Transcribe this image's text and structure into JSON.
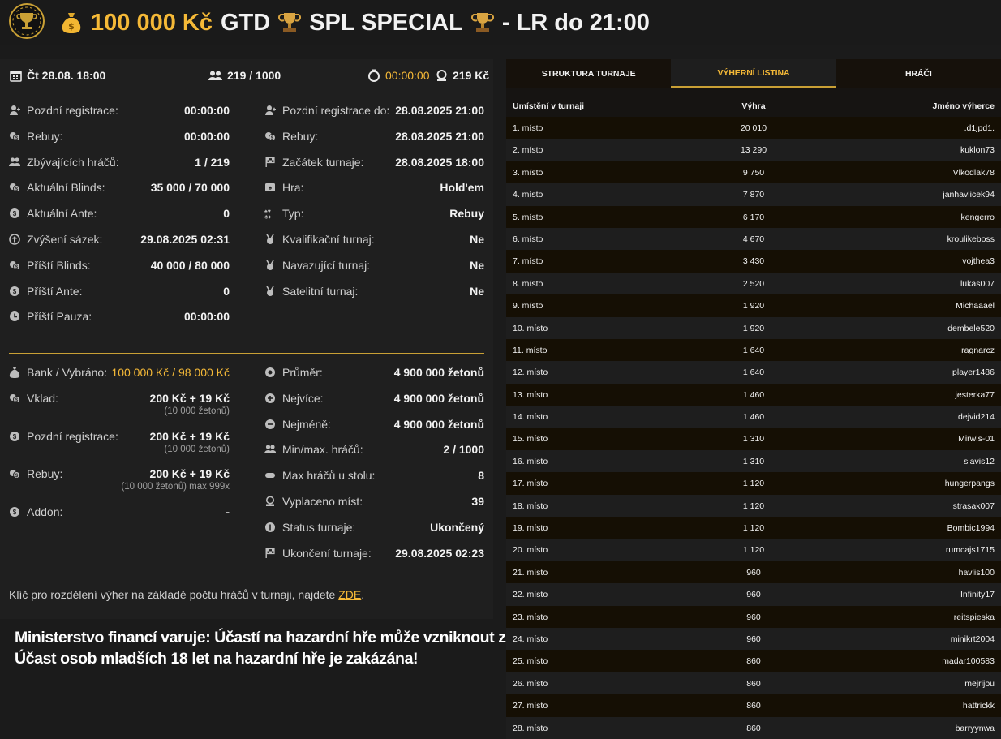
{
  "header": {
    "amount": "100 000 Kč",
    "gtd": "GTD",
    "name": "SPL SPECIAL",
    "suffix": "- LR do 21:00"
  },
  "summary": {
    "date": "Čt 28.08. 18:00",
    "players": "219 / 1000",
    "timer": "00:00:00",
    "buyin": "219 Kč"
  },
  "details_left": [
    {
      "icon": "user-plus-icon",
      "label": "Pozdní registrace:",
      "value": "00:00:00"
    },
    {
      "icon": "money-icon",
      "label": "Rebuy:",
      "value": "00:00:00"
    },
    {
      "icon": "users-icon",
      "label": "Zbývajících hráčů:",
      "value": "1 / 219"
    },
    {
      "icon": "money-icon",
      "label": "Aktuální Blinds:",
      "value": "35 000 / 70 000"
    },
    {
      "icon": "coin-icon",
      "label": "Aktuální Ante:",
      "value": "0"
    },
    {
      "icon": "arrow-up-circle-icon",
      "label": "Zvýšení sázek:",
      "value": "29.08.2025 02:31"
    },
    {
      "icon": "money-icon",
      "label": "Příští Blinds:",
      "value": "40 000 / 80 000"
    },
    {
      "icon": "coin-icon",
      "label": "Příští Ante:",
      "value": "0"
    },
    {
      "icon": "clock-icon",
      "label": "Příští Pauza:",
      "value": "00:00:00"
    }
  ],
  "details_right": [
    {
      "icon": "user-plus-icon",
      "label": "Pozdní registrace do:",
      "value": "28.08.2025 21:00"
    },
    {
      "icon": "money-icon",
      "label": "Rebuy:",
      "value": "28.08.2025 21:00"
    },
    {
      "icon": "flag-icon",
      "label": "Začátek turnaje:",
      "value": "28.08.2025 18:00"
    },
    {
      "icon": "cards-icon",
      "label": "Hra:",
      "value": "Hold'em"
    },
    {
      "icon": "suits-icon",
      "label": "Typ:",
      "value": "Rebuy"
    },
    {
      "icon": "medal-icon",
      "label": "Kvalifikační turnaj:",
      "value": "Ne"
    },
    {
      "icon": "medal-icon",
      "label": "Navazující turnaj:",
      "value": "Ne"
    },
    {
      "icon": "medal-icon",
      "label": "Satelitní turnaj:",
      "value": "Ne"
    }
  ],
  "money_left": [
    {
      "icon": "money-bag-icon",
      "label": "Bank / Vybráno:",
      "value": "100 000 Kč / 98 000 Kč",
      "sub": ""
    },
    {
      "icon": "money-icon",
      "label": "Vklad:",
      "value": "200 Kč + 19 Kč",
      "sub": "(10 000 žetonů)"
    },
    {
      "icon": "coin-icon",
      "label": "Pozdní registrace:",
      "value": "200 Kč + 19 Kč",
      "sub": "(10 000 žetonů)"
    },
    {
      "icon": "money-icon",
      "label": "Rebuy:",
      "value": "200 Kč + 19 Kč",
      "sub": "(10 000 žetonů) max 999x"
    },
    {
      "icon": "coin-icon",
      "label": "Addon:",
      "value": "-",
      "sub": ""
    }
  ],
  "money_right": [
    {
      "icon": "chip-icon",
      "label": "Průměr:",
      "value": "4 900 000 žetonů"
    },
    {
      "icon": "chip-plus-icon",
      "label": "Nejvíce:",
      "value": "4 900 000 žetonů"
    },
    {
      "icon": "chip-minus-icon",
      "label": "Nejméně:",
      "value": "4 900 000 žetonů"
    },
    {
      "icon": "users-icon",
      "label": "Min/max. hráčů:",
      "value": "2 / 1000"
    },
    {
      "icon": "table-icon",
      "label": "Max hráčů u stolu:",
      "value": "8"
    },
    {
      "icon": "payout-icon",
      "label": "Vyplaceno míst:",
      "value": "39"
    },
    {
      "icon": "info-icon",
      "label": "Status turnaje:",
      "value": "Ukončený"
    },
    {
      "icon": "flag-icon",
      "label": "Ukončení turnaje:",
      "value": "29.08.2025 02:23"
    }
  ],
  "footnote": {
    "text": "Klíč pro rozdělení výher na základě počtu hráčů v turnaji, najdete ",
    "link": "ZDE",
    "end": "."
  },
  "warning": {
    "line1": "Ministerstvo financí varuje: Účastí na hazardní hře může vzniknout závislost!",
    "line2": "Účast osob mladších 18 let na hazardní hře je zakázána!"
  },
  "tabs": [
    "STRUKTURA TURNAJE",
    "VÝHERNÍ LISTINA",
    "HRÁČI"
  ],
  "active_tab": 1,
  "table": {
    "headers": [
      "Umístění v turnaji",
      "Výhra",
      "Jméno výherce"
    ],
    "rows": [
      [
        "1. místo",
        "20 010",
        ".d1jpd1."
      ],
      [
        "2. místo",
        "13 290",
        "kuklon73"
      ],
      [
        "3. místo",
        "9 750",
        "Vlkodlak78"
      ],
      [
        "4. místo",
        "7 870",
        "janhavlicek94"
      ],
      [
        "5. místo",
        "6 170",
        "kengerro"
      ],
      [
        "6. místo",
        "4 670",
        "kroulikeboss"
      ],
      [
        "7. místo",
        "3 430",
        "vojthea3"
      ],
      [
        "8. místo",
        "2 520",
        "lukas007"
      ],
      [
        "9. místo",
        "1 920",
        "Michaaael"
      ],
      [
        "10. místo",
        "1 920",
        "dembele520"
      ],
      [
        "11. místo",
        "1 640",
        "ragnarcz"
      ],
      [
        "12. místo",
        "1 640",
        "player1486"
      ],
      [
        "13. místo",
        "1 460",
        "jesterka77"
      ],
      [
        "14. místo",
        "1 460",
        "dejvid214"
      ],
      [
        "15. místo",
        "1 310",
        "Mirwis-01"
      ],
      [
        "16. místo",
        "1 310",
        "slavis12"
      ],
      [
        "17. místo",
        "1 120",
        "hungerpangs"
      ],
      [
        "18. místo",
        "1 120",
        "strasak007"
      ],
      [
        "19. místo",
        "1 120",
        "Bombic1994"
      ],
      [
        "20. místo",
        "1 120",
        "rumcajs1715"
      ],
      [
        "21. místo",
        "960",
        "havlis100"
      ],
      [
        "22. místo",
        "960",
        "Infinity17"
      ],
      [
        "23. místo",
        "960",
        "reitspieska"
      ],
      [
        "24. místo",
        "960",
        "minikrt2004"
      ],
      [
        "25. místo",
        "860",
        "madar100583"
      ],
      [
        "26. místo",
        "860",
        "mejrijou"
      ],
      [
        "27. místo",
        "860",
        "hattrickk"
      ],
      [
        "28. místo",
        "860",
        "barryynwa"
      ]
    ]
  },
  "colors": {
    "accent": "#f5b937",
    "divider": "#c9a035",
    "panel": "#1f1f1f",
    "row_dark": "#150f04",
    "row_light": "#1e1e1e"
  }
}
